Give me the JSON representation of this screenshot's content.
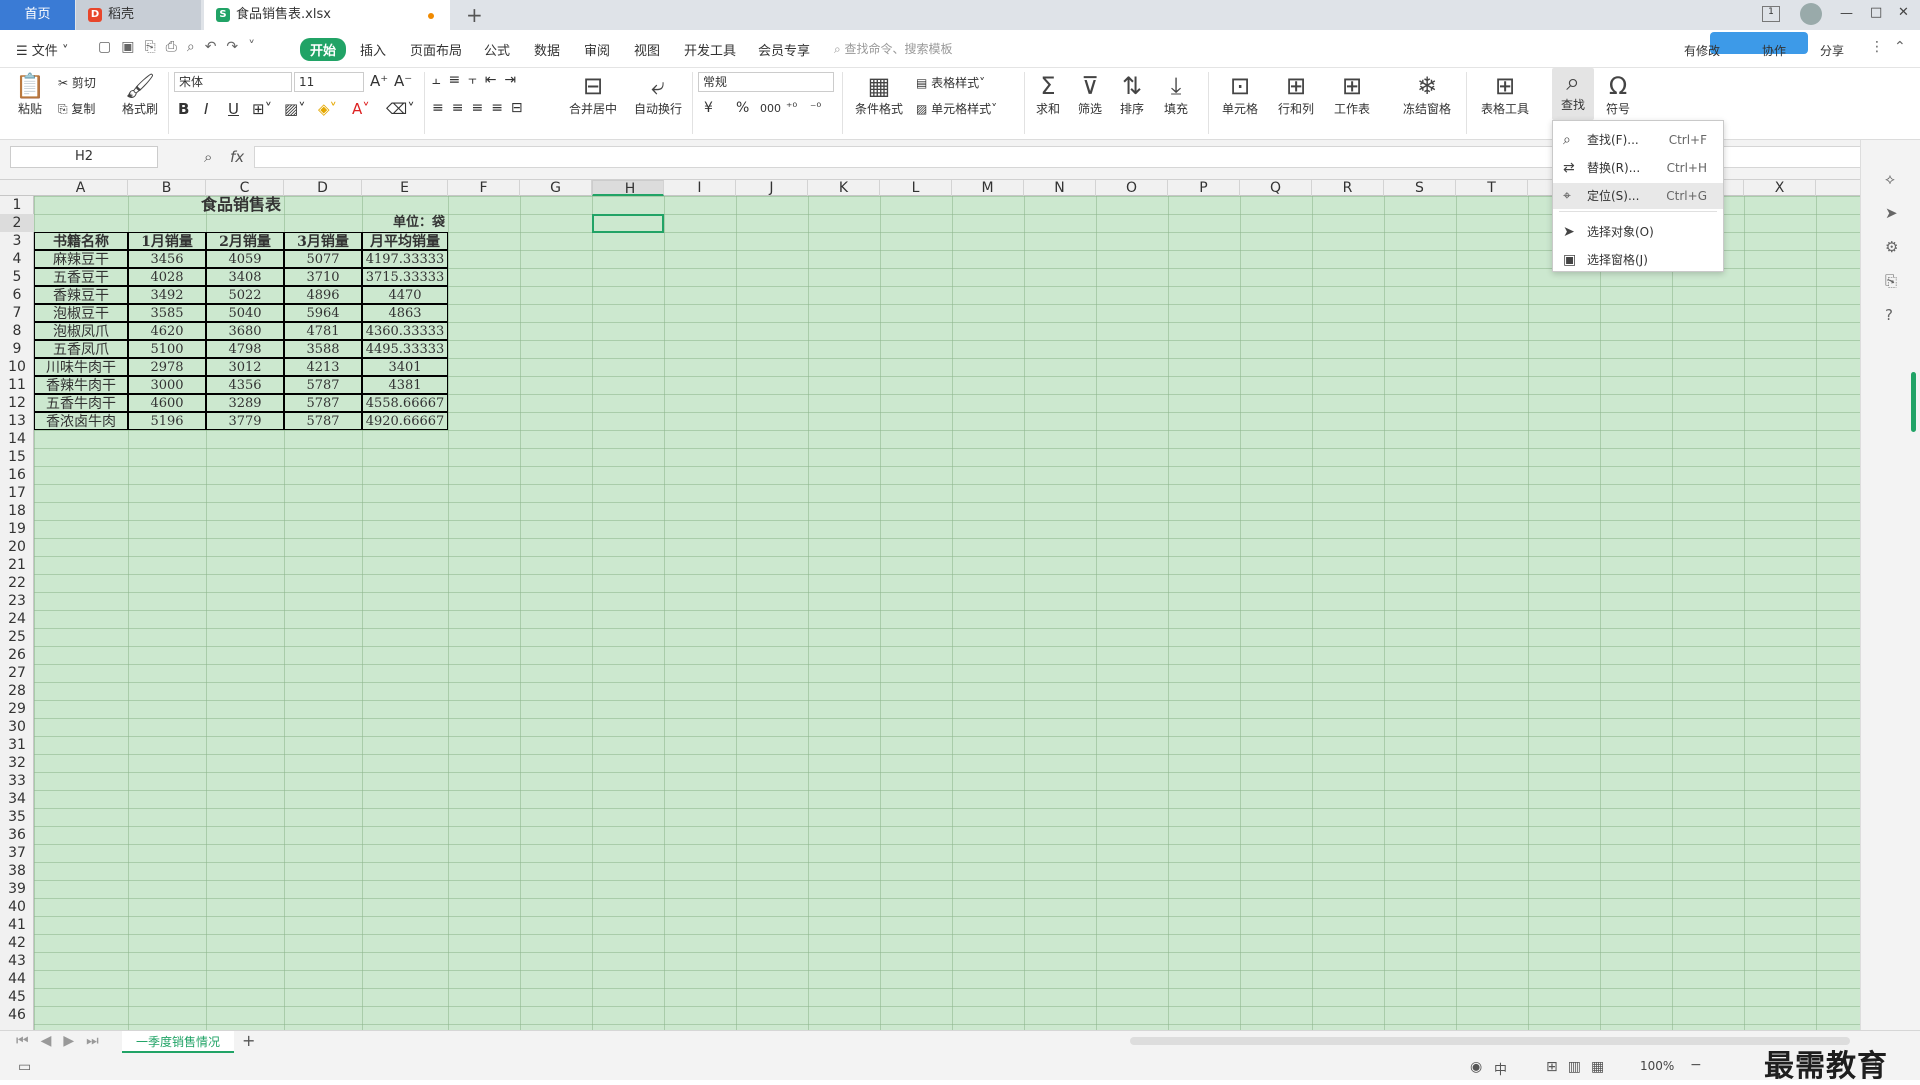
{
  "titlebar": {
    "tabs": [
      {
        "label": "首页"
      },
      {
        "label": "稻壳"
      },
      {
        "label": "食品销售表.xlsx"
      }
    ],
    "add_tab": "+",
    "window_controls": [
      "—",
      "□",
      "✕"
    ]
  },
  "menubar": {
    "file_label": "文件",
    "items": [
      "开始",
      "插入",
      "页面布局",
      "公式",
      "数据",
      "审阅",
      "视图",
      "开发工具",
      "会员专享"
    ],
    "active_item": "开始",
    "search_placeholder": "查找命令、搜索模板",
    "right_labels": [
      "有修改",
      "协作",
      "分享"
    ]
  },
  "ribbon": {
    "paste": "粘贴",
    "cut": "剪切",
    "copy": "复制",
    "format_painter": "格式刷",
    "font_name": "宋体",
    "font_size": "11",
    "bold": "B",
    "italic": "I",
    "underline": "U",
    "merge_center": "合并居中",
    "wrap_text": "自动换行",
    "number_format": "常规",
    "currency": "¥",
    "percent": "%",
    "thousands": "000",
    "conditional_format": "条件格式",
    "table_style": "表格样式",
    "cell_style": "单元格样式",
    "sum": "求和",
    "filter": "筛选",
    "sort": "排序",
    "fill": "填充",
    "cell": "单元格",
    "row_col": "行和列",
    "worksheet": "工作表",
    "freeze": "冻结窗格",
    "table_tools": "表格工具",
    "find": "查找",
    "symbol": "符号"
  },
  "find_dropdown": {
    "items": [
      {
        "label": "查找(F)...",
        "shortcut": "Ctrl+F",
        "icon": "search-icon"
      },
      {
        "label": "替换(R)...",
        "shortcut": "Ctrl+H",
        "icon": "replace-icon"
      },
      {
        "label": "定位(S)...",
        "shortcut": "Ctrl+G",
        "icon": "locate-icon"
      },
      {
        "label": "选择对象(O)",
        "shortcut": "",
        "icon": "select-object-icon"
      },
      {
        "label": "选择窗格(J)",
        "shortcut": "",
        "icon": "select-pane-icon"
      }
    ]
  },
  "formula_bar": {
    "name_box": "H2",
    "fx": "fx",
    "formula": ""
  },
  "sheet": {
    "columns": [
      "A",
      "B",
      "C",
      "D",
      "E",
      "F",
      "G",
      "H",
      "I",
      "J",
      "K",
      "L",
      "M",
      "N",
      "O",
      "P",
      "Q",
      "R",
      "S",
      "T",
      "U",
      "V",
      "W",
      "X"
    ],
    "selected_column": "H",
    "selected_row": 2,
    "title": "食品销售表",
    "unit": "单位：袋",
    "headers": [
      "书籍名称",
      "1月销量",
      "2月销量",
      "3月销量",
      "月平均销量"
    ],
    "rows": [
      [
        "麻辣豆干",
        "3456",
        "4059",
        "5077",
        "4197.33333"
      ],
      [
        "五香豆干",
        "4028",
        "3408",
        "3710",
        "3715.33333"
      ],
      [
        "香辣豆干",
        "3492",
        "5022",
        "4896",
        "4470"
      ],
      [
        "泡椒豆干",
        "3585",
        "5040",
        "5964",
        "4863"
      ],
      [
        "泡椒凤爪",
        "4620",
        "3680",
        "4781",
        "4360.33333"
      ],
      [
        "五香凤爪",
        "5100",
        "4798",
        "3588",
        "4495.33333"
      ],
      [
        "川味牛肉干",
        "2978",
        "3012",
        "4213",
        "3401"
      ],
      [
        "香辣牛肉干",
        "3000",
        "4356",
        "5787",
        "4381"
      ],
      [
        "五香牛肉干",
        "4600",
        "3289",
        "5787",
        "4558.66667"
      ],
      [
        "香浓卤牛肉",
        "5196",
        "3779",
        "5787",
        "4920.66667"
      ]
    ]
  },
  "statusbar": {
    "sheet_tab": "一季度销售情况",
    "add_sheet": "+",
    "zoom": "100%",
    "input_mode": "中"
  },
  "watermark": "最需教育",
  "colors": {
    "accent": "#21a366",
    "grid_bg": "#cce8cf",
    "home_tab": "#3a7bd5"
  }
}
